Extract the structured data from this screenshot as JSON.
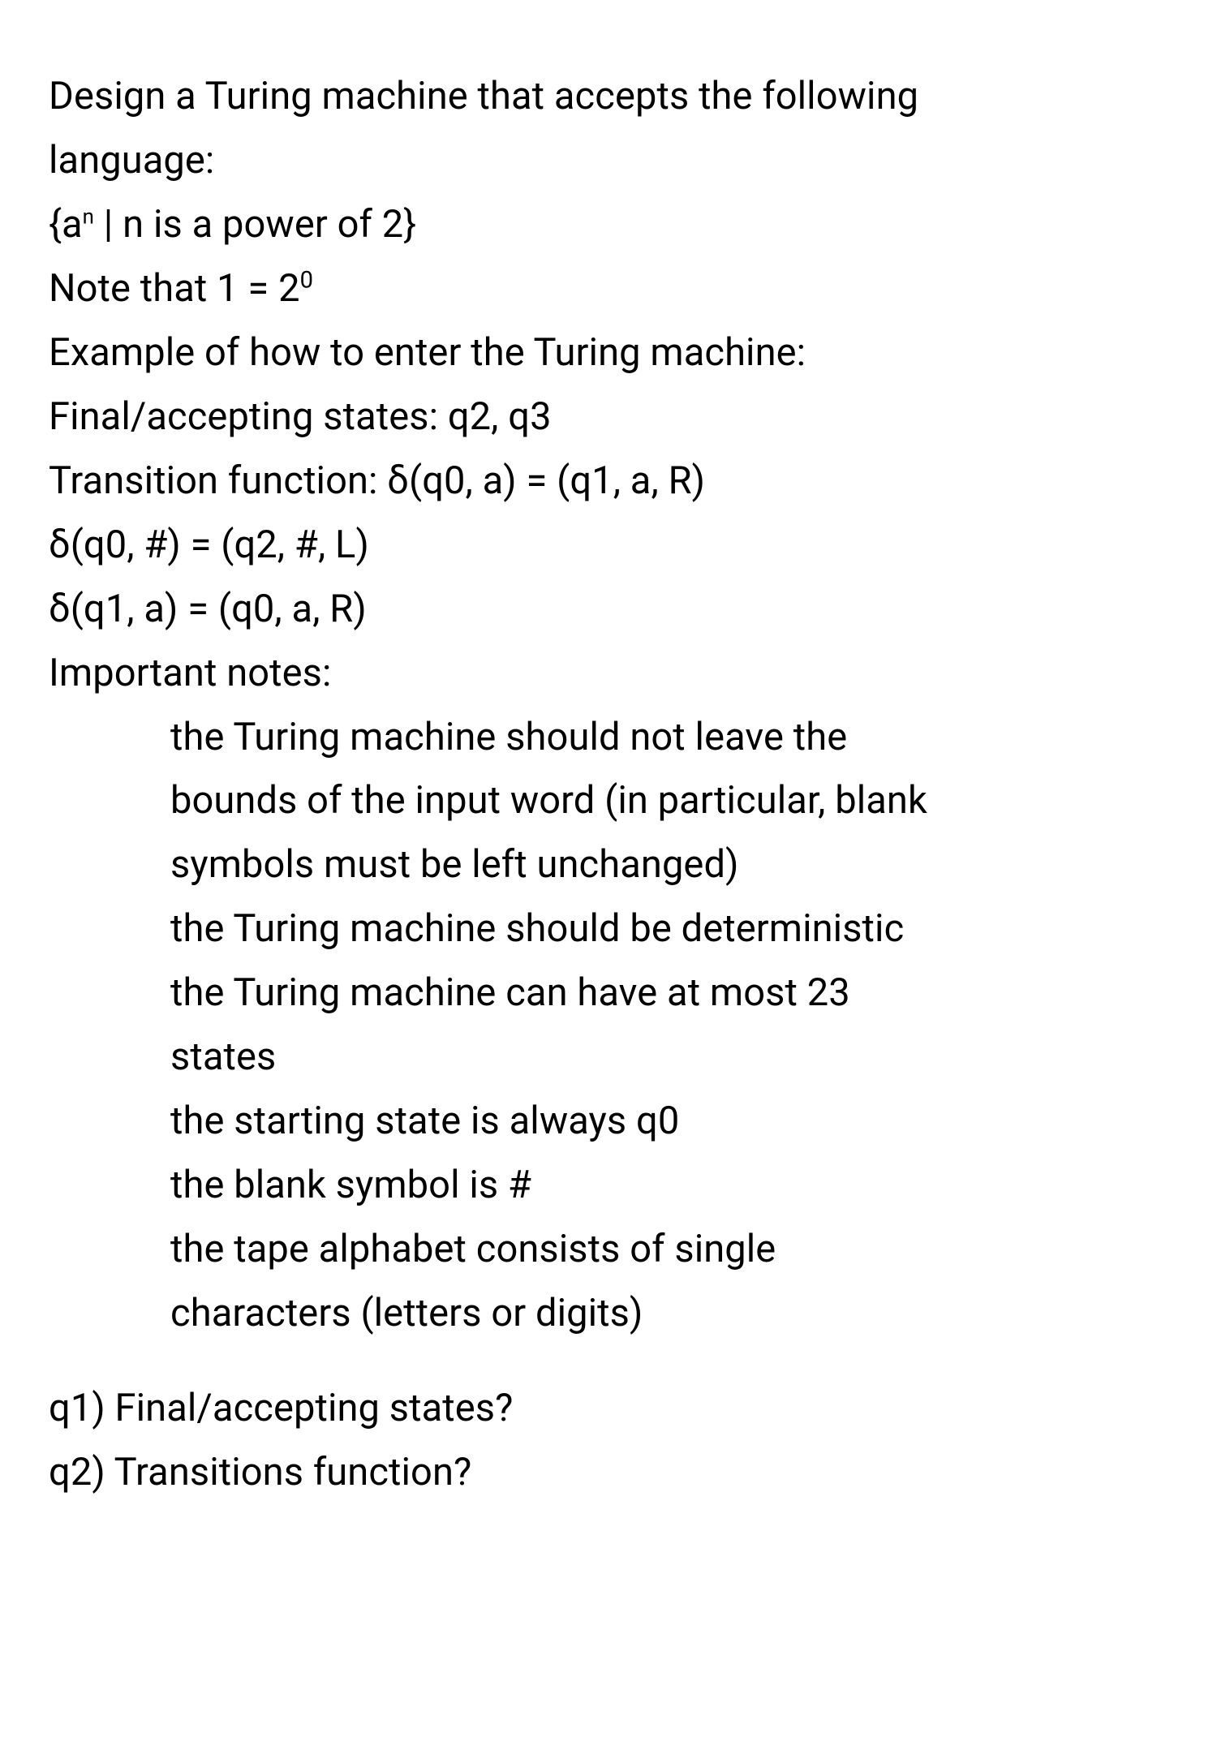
{
  "intro": {
    "l1": "Design a Turing machine that accepts the following",
    "l2": "language:",
    "lang_open": "{a",
    "lang_sup": "n",
    "lang_rest": " | n is a power of 2}",
    "note_pre": "Note that 1 = 2",
    "note_sup": "0",
    "example_intro": "Example of how to enter the Turing machine:",
    "final_example": "Final/accepting states: q2, q3",
    "trans_label": "Transition function: δ(q0, a) = (q1, a, R)",
    "trans2": "δ(q0, #) = (q2, #, L)",
    "trans3": "δ(q1, a) = (q0, a, R)",
    "important": "Important notes:"
  },
  "bullets": {
    "b1a": "the Turing machine should not leave the",
    "b1b": "bounds of the input word (in particular, blank",
    "b1c": "symbols must be left unchanged)",
    "b2": "the Turing machine should be deterministic",
    "b3a": "the Turing machine can have at most 23",
    "b3b": "states",
    "b4": "the starting state is always q0",
    "b5": "the blank symbol is #",
    "b6a": "the tape alphabet consists of single",
    "b6b": "characters (letters or digits)"
  },
  "questions": {
    "q1": "q1) Final/accepting states?",
    "q2": "q2) Transitions function?"
  }
}
